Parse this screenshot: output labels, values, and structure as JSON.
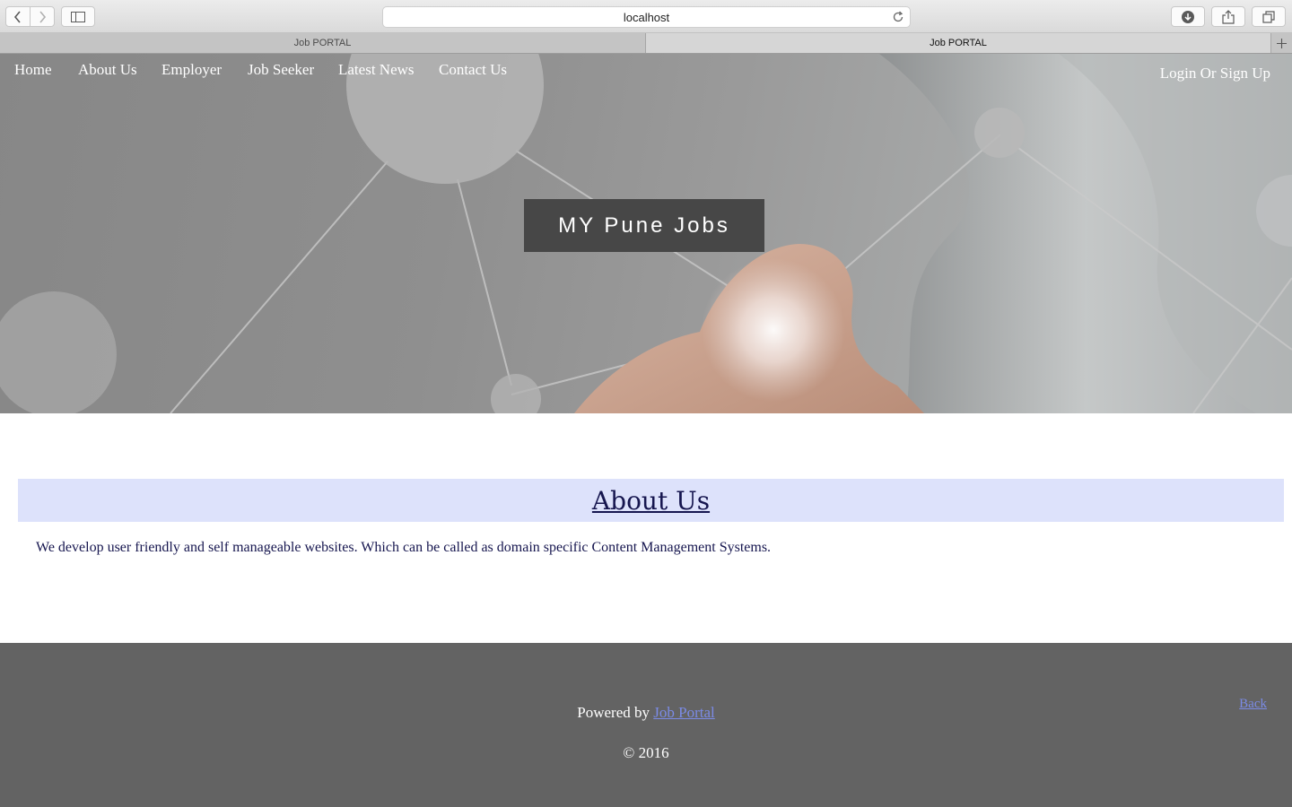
{
  "browser": {
    "url": "localhost",
    "tabs": [
      {
        "label": "Job PORTAL",
        "active": false
      },
      {
        "label": "Job PORTAL",
        "active": true
      }
    ],
    "icons": [
      "back-arrow-icon",
      "forward-arrow-icon",
      "sidebar-icon",
      "reload-icon",
      "download-icon",
      "share-icon",
      "tabs-overview-icon",
      "plus-icon"
    ]
  },
  "nav": {
    "home": "Home",
    "about": "About Us",
    "employer": "Employer",
    "job_seeker": "Job Seeker",
    "latest_news": "Latest News",
    "contact": "Contact Us",
    "login": "Login Or Sign Up"
  },
  "hero": {
    "brand": "MY Pune Jobs"
  },
  "about": {
    "title": "About Us",
    "text": "We develop user friendly and self manageable websites. Which can be called as domain specific Content Management Systems."
  },
  "footer": {
    "powered_prefix": "Powered by ",
    "powered_link": "Job Portal",
    "copyright": "© 2016",
    "back": "Back"
  },
  "colors": {
    "about_band": "#dde2fb",
    "about_text": "#16164f",
    "footer_bg": "#636363",
    "link": "#7b8be6",
    "brand_bg": "#474747"
  }
}
